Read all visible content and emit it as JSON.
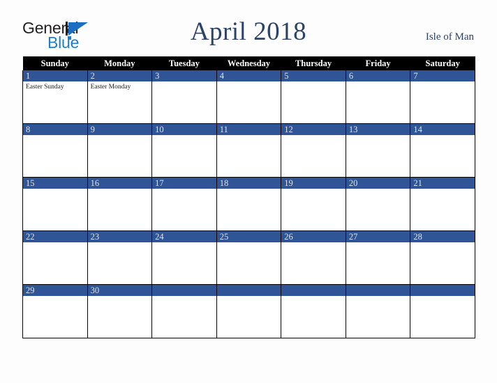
{
  "header": {
    "logo": {
      "primary_text": "General",
      "secondary_text": "Blue",
      "primary_color": "#231f20",
      "secondary_color": "#1b7fd1",
      "mark_color": "#1b6ec2"
    },
    "title": "April 2018",
    "title_color": "#2b4269",
    "locale": "Isle of Man"
  },
  "calendar": {
    "accent_color": "#2f5597",
    "header_bg": "#000000",
    "weekday_headers": [
      "Sunday",
      "Monday",
      "Tuesday",
      "Wednesday",
      "Thursday",
      "Friday",
      "Saturday"
    ],
    "weeks": [
      [
        {
          "day": "1",
          "events": [
            "Easter Sunday"
          ]
        },
        {
          "day": "2",
          "events": [
            "Easter Monday"
          ]
        },
        {
          "day": "3",
          "events": []
        },
        {
          "day": "4",
          "events": []
        },
        {
          "day": "5",
          "events": []
        },
        {
          "day": "6",
          "events": []
        },
        {
          "day": "7",
          "events": []
        }
      ],
      [
        {
          "day": "8",
          "events": []
        },
        {
          "day": "9",
          "events": []
        },
        {
          "day": "10",
          "events": []
        },
        {
          "day": "11",
          "events": []
        },
        {
          "day": "12",
          "events": []
        },
        {
          "day": "13",
          "events": []
        },
        {
          "day": "14",
          "events": []
        }
      ],
      [
        {
          "day": "15",
          "events": []
        },
        {
          "day": "16",
          "events": []
        },
        {
          "day": "17",
          "events": []
        },
        {
          "day": "18",
          "events": []
        },
        {
          "day": "19",
          "events": []
        },
        {
          "day": "20",
          "events": []
        },
        {
          "day": "21",
          "events": []
        }
      ],
      [
        {
          "day": "22",
          "events": []
        },
        {
          "day": "23",
          "events": []
        },
        {
          "day": "24",
          "events": []
        },
        {
          "day": "25",
          "events": []
        },
        {
          "day": "26",
          "events": []
        },
        {
          "day": "27",
          "events": []
        },
        {
          "day": "28",
          "events": []
        }
      ],
      [
        {
          "day": "29",
          "events": []
        },
        {
          "day": "30",
          "events": []
        },
        {
          "day": "",
          "events": []
        },
        {
          "day": "",
          "events": []
        },
        {
          "day": "",
          "events": []
        },
        {
          "day": "",
          "events": []
        },
        {
          "day": "",
          "events": []
        }
      ]
    ]
  }
}
